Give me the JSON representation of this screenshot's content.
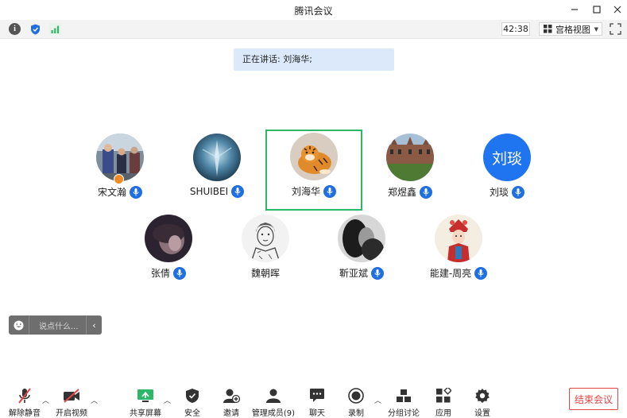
{
  "window": {
    "title": "腾讯会议"
  },
  "statusbar": {
    "timer": "42:38",
    "view_label": "宫格视图"
  },
  "speaking": {
    "text": "正在讲话: 刘海华;"
  },
  "participants": [
    {
      "name": "宋文瀚",
      "avatar": "photo-crowd",
      "host": true
    },
    {
      "name": "SHUIBEI",
      "avatar": "photo-ice"
    },
    {
      "name": "刘海华",
      "avatar": "tiger-illustration",
      "active": true
    },
    {
      "name": "郑煜鑫",
      "avatar": "photo-building"
    },
    {
      "name": "刘琰",
      "avatar": "initials",
      "initials": "刘琰"
    },
    {
      "name": "张倩",
      "avatar": "photo-dark"
    },
    {
      "name": "魏朝晖",
      "avatar": "sketch-portrait"
    },
    {
      "name": "靳亚斌",
      "avatar": "photo-bw"
    },
    {
      "name": "能建-周亮",
      "avatar": "opera-character"
    }
  ],
  "chat": {
    "placeholder": "说点什么..."
  },
  "toolbar": {
    "unmute": "解除静音",
    "video": "开启视频",
    "share": "共享屏幕",
    "security": "安全",
    "invite": "邀请",
    "members": "管理成员(9)",
    "chat": "聊天",
    "record": "录制",
    "breakout": "分组讨论",
    "apps": "应用",
    "settings": "设置",
    "end": "结束会议"
  },
  "colors": {
    "accent": "#1f6fe0",
    "active_border": "#2fb769",
    "end": "#e34444",
    "banner": "#dbe9fb"
  }
}
